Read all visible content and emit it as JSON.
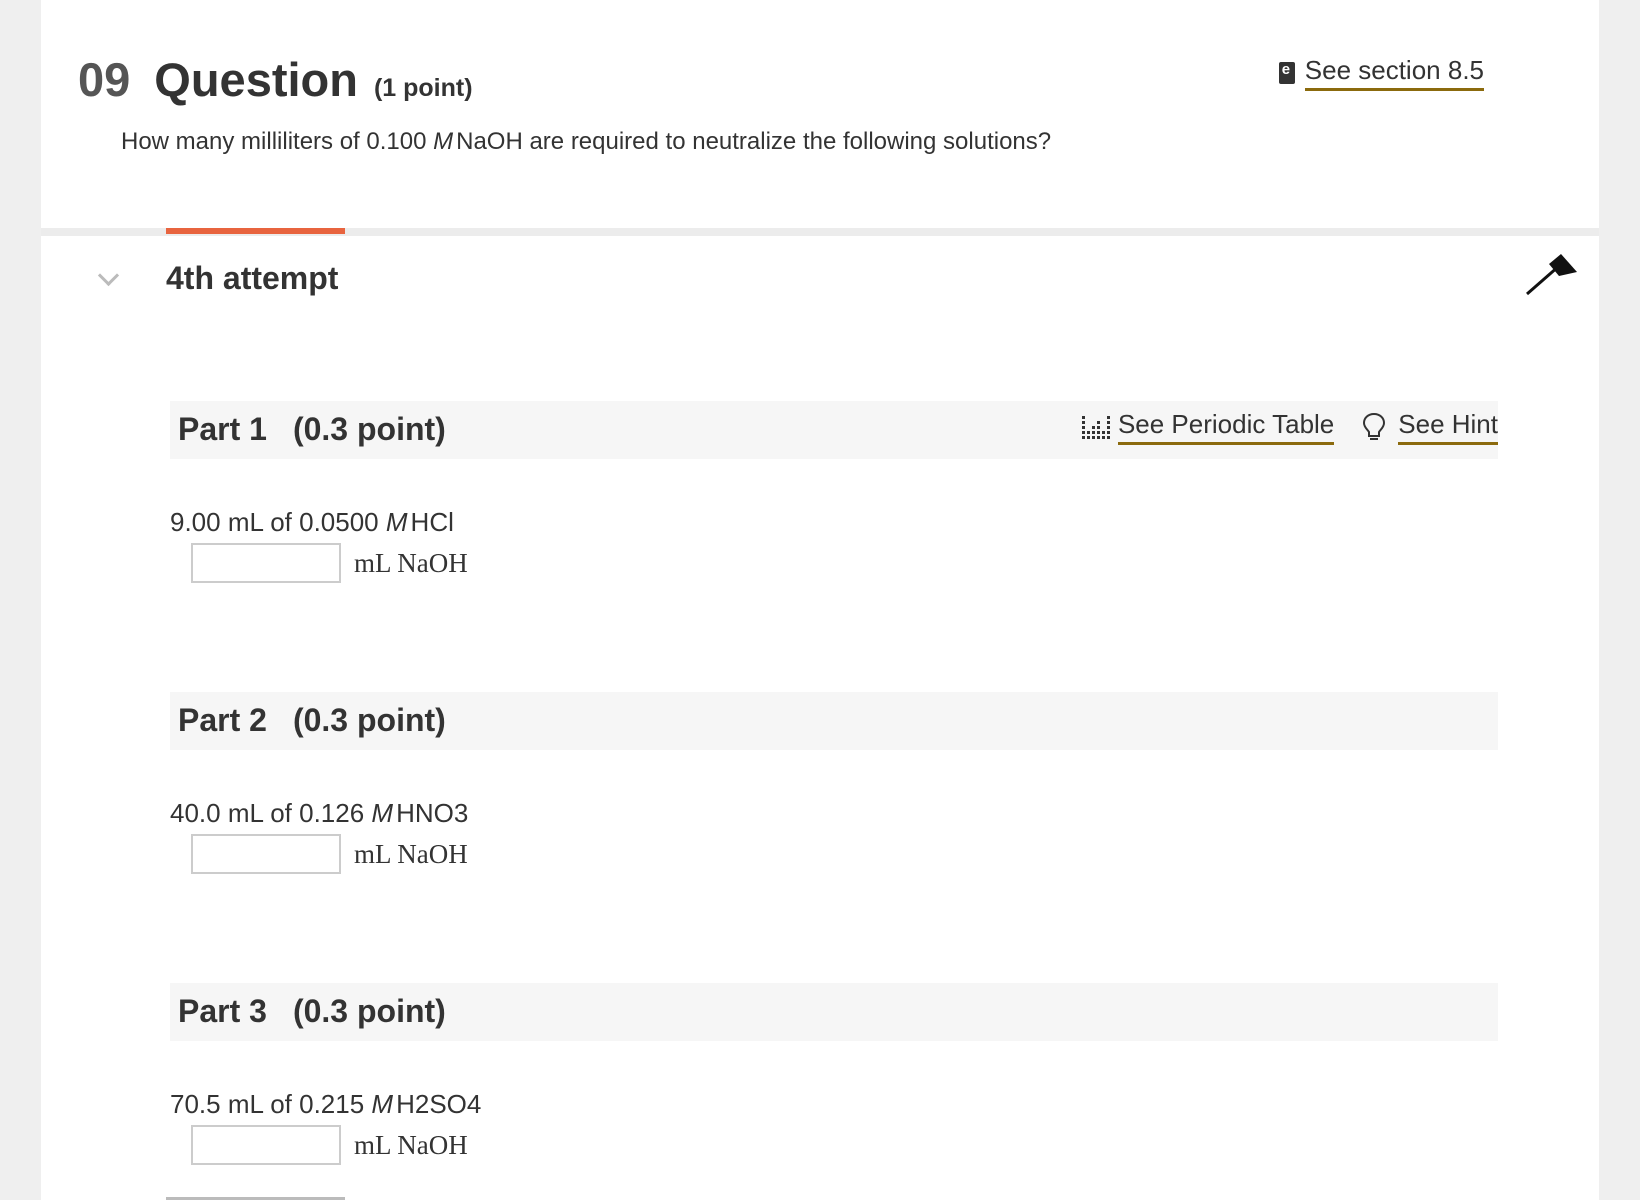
{
  "question": {
    "number": "09",
    "word": "Question",
    "points": "(1 point)",
    "text_before": "How many milliliters of 0.100",
    "text_m": "M",
    "text_after": "NaOH are required to neutralize the following solutions?",
    "section_link": "See section 8.5"
  },
  "attempt": {
    "label": "4th attempt"
  },
  "links": {
    "periodic_table": "See Periodic Table",
    "hint": "See Hint"
  },
  "parts": [
    {
      "title": "Part 1",
      "points": "(0.3 point)",
      "prompt_before": "9.00 mL of 0.0500",
      "m": "M",
      "prompt_after": "HCl",
      "value": "",
      "unit": "mL NaOH"
    },
    {
      "title": "Part 2",
      "points": "(0.3 point)",
      "prompt_before": "40.0 mL of 0.126",
      "m": "M",
      "prompt_after": "HNO3",
      "value": "",
      "unit": "mL NaOH"
    },
    {
      "title": "Part 3",
      "points": "(0.3 point)",
      "prompt_before": "70.5 mL of 0.215",
      "m": "M",
      "prompt_after": "H2SO4",
      "value": "",
      "unit": "mL NaOH"
    }
  ],
  "colors": {
    "accent": "#e8643f",
    "link_underline": "#8b6a0d"
  }
}
